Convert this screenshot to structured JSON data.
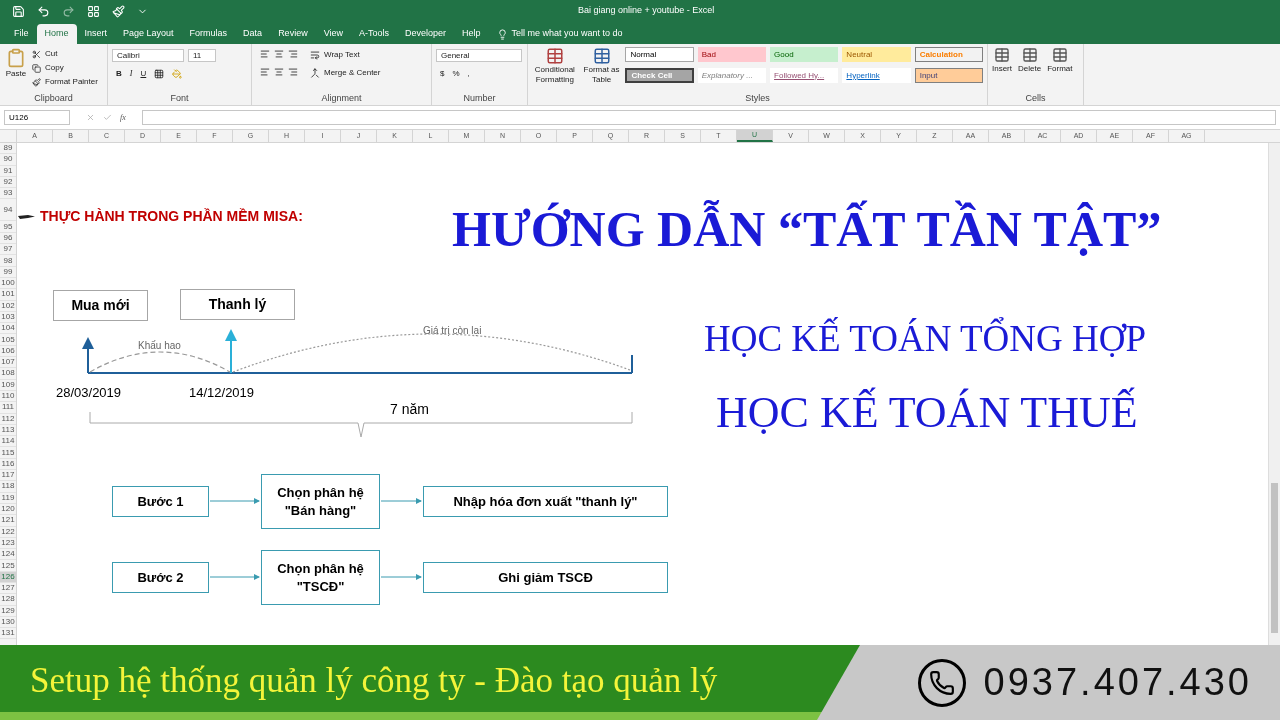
{
  "window": {
    "title": "Bai giang online + youtube  -  Excel"
  },
  "tabs": [
    {
      "label": "File",
      "selected": false
    },
    {
      "label": "Home",
      "selected": true
    },
    {
      "label": "Insert",
      "selected": false
    },
    {
      "label": "Page Layout",
      "selected": false
    },
    {
      "label": "Formulas",
      "selected": false
    },
    {
      "label": "Data",
      "selected": false
    },
    {
      "label": "Review",
      "selected": false
    },
    {
      "label": "View",
      "selected": false
    },
    {
      "label": "A-Tools",
      "selected": false
    },
    {
      "label": "Developer",
      "selected": false
    },
    {
      "label": "Help",
      "selected": false
    }
  ],
  "tell_me": "Tell me what you want to do",
  "ribbon": {
    "clipboard": {
      "paste": "Paste",
      "cut": "Cut",
      "copy": "Copy",
      "format_painter": "Format Painter",
      "label": "Clipboard"
    },
    "font": {
      "name": "Calibri",
      "size": "11",
      "styles": [
        "B",
        "I",
        "U"
      ],
      "label": "Font"
    },
    "alignment": {
      "wrap": "Wrap Text",
      "merge": "Merge & Center",
      "label": "Alignment"
    },
    "number": {
      "format": "General",
      "symbols": [
        "$",
        "%",
        ","
      ],
      "label": "Number"
    },
    "styles": {
      "conditional": [
        "Conditional",
        "Formatting"
      ],
      "table": [
        "Format as",
        "Table"
      ],
      "label": "Styles",
      "cells": [
        {
          "label": "Normal",
          "kind": "normal"
        },
        {
          "label": "Bad",
          "kind": "bad"
        },
        {
          "label": "Good",
          "kind": "good"
        },
        {
          "label": "Neutral",
          "kind": "neutral"
        },
        {
          "label": "Calculation",
          "kind": "calculation"
        },
        {
          "label": "Check Cell",
          "kind": "check"
        },
        {
          "label": "Explanatory ...",
          "kind": "explanatory"
        },
        {
          "label": "Followed Hy...",
          "kind": "followed"
        },
        {
          "label": "Hyperlink",
          "kind": "hyperlink"
        },
        {
          "label": "Input",
          "kind": "input"
        }
      ]
    },
    "cells": {
      "buttons": [
        "Insert",
        "Delete",
        "Format"
      ],
      "label": "Cells"
    }
  },
  "formula_bar": {
    "name_box": "U126",
    "fx": "fx"
  },
  "columns": [
    {
      "label": "A",
      "selected": false
    },
    {
      "label": "B",
      "selected": false
    },
    {
      "label": "C",
      "selected": false
    },
    {
      "label": "D",
      "selected": false
    },
    {
      "label": "E",
      "selected": false
    },
    {
      "label": "F",
      "selected": false
    },
    {
      "label": "G",
      "selected": false
    },
    {
      "label": "H",
      "selected": false
    },
    {
      "label": "I",
      "selected": false
    },
    {
      "label": "J",
      "selected": false
    },
    {
      "label": "K",
      "selected": false
    },
    {
      "label": "L",
      "selected": false
    },
    {
      "label": "M",
      "selected": false
    },
    {
      "label": "N",
      "selected": false
    },
    {
      "label": "O",
      "selected": false
    },
    {
      "label": "P",
      "selected": false
    },
    {
      "label": "Q",
      "selected": false
    },
    {
      "label": "R",
      "selected": false
    },
    {
      "label": "S",
      "selected": false
    },
    {
      "label": "T",
      "selected": false
    },
    {
      "label": "U",
      "selected": true
    },
    {
      "label": "V",
      "selected": false
    },
    {
      "label": "W",
      "selected": false
    },
    {
      "label": "X",
      "selected": false
    },
    {
      "label": "Y",
      "selected": false
    },
    {
      "label": "Z",
      "selected": false
    },
    {
      "label": "AA",
      "selected": false
    },
    {
      "label": "AB",
      "selected": false
    },
    {
      "label": "AC",
      "selected": false
    },
    {
      "label": "AD",
      "selected": false
    },
    {
      "label": "AE",
      "selected": false
    },
    {
      "label": "AF",
      "selected": false
    },
    {
      "label": "AG",
      "selected": false
    }
  ],
  "rows": [
    {
      "label": "89",
      "selected": false
    },
    {
      "label": "90",
      "selected": false
    },
    {
      "label": "91",
      "selected": false
    },
    {
      "label": "92",
      "selected": false
    },
    {
      "label": "93",
      "selected": false
    },
    {
      "label": "94",
      "selected": false
    },
    {
      "label": "95",
      "selected": false
    },
    {
      "label": "96",
      "selected": false
    },
    {
      "label": "97",
      "selected": false
    },
    {
      "label": "98",
      "selected": false
    },
    {
      "label": "99",
      "selected": false
    },
    {
      "label": "100",
      "selected": false
    },
    {
      "label": "101",
      "selected": false
    },
    {
      "label": "102",
      "selected": false
    },
    {
      "label": "103",
      "selected": false
    },
    {
      "label": "104",
      "selected": false
    },
    {
      "label": "105",
      "selected": false
    },
    {
      "label": "106",
      "selected": false
    },
    {
      "label": "107",
      "selected": false
    },
    {
      "label": "108",
      "selected": false
    },
    {
      "label": "109",
      "selected": false
    },
    {
      "label": "110",
      "selected": false
    },
    {
      "label": "111",
      "selected": false
    },
    {
      "label": "112",
      "selected": false
    },
    {
      "label": "113",
      "selected": false
    },
    {
      "label": "114",
      "selected": false
    },
    {
      "label": "115",
      "selected": false
    },
    {
      "label": "116",
      "selected": false
    },
    {
      "label": "117",
      "selected": false
    },
    {
      "label": "118",
      "selected": false
    },
    {
      "label": "119",
      "selected": false
    },
    {
      "label": "120",
      "selected": false
    },
    {
      "label": "121",
      "selected": false
    },
    {
      "label": "122",
      "selected": false
    },
    {
      "label": "123",
      "selected": false
    },
    {
      "label": "124",
      "selected": false
    },
    {
      "label": "125",
      "selected": false
    },
    {
      "label": "126",
      "selected": true
    },
    {
      "label": "127",
      "selected": false
    },
    {
      "label": "128",
      "selected": false
    },
    {
      "label": "129",
      "selected": false
    },
    {
      "label": "130",
      "selected": false
    },
    {
      "label": "131",
      "selected": false
    }
  ],
  "sheet": {
    "heading": "THỰC HÀNH TRONG PHẦN MỀM MISA:",
    "title": "HƯỚNG DẪN “TẤT TẦN TẬT”",
    "subtitles": [
      "HỌC KẾ TOÁN TỔNG HỢP",
      "HỌC KẾ TOÁN THUẾ"
    ],
    "timeline": {
      "events": [
        {
          "label": "Mua mới",
          "date": "28/03/2019"
        },
        {
          "label": "Thanh lý",
          "date": "14/12/2019"
        }
      ],
      "segments": [
        {
          "label": "Khấu hao",
          "kind": "dashed"
        },
        {
          "label": "Giá trị còn lại",
          "kind": "dotted"
        }
      ],
      "span": "7 năm"
    },
    "steps": [
      {
        "label": "Bước 1",
        "module": "Chọn phân hệ\n\"Bán hàng\"",
        "action": "Nhập hóa đơn xuất \"thanh lý\""
      },
      {
        "label": "Bước 2",
        "module": "Chọn phân hệ\n\"TSCĐ\"",
        "action": "Ghi giảm TSCĐ"
      }
    ]
  },
  "banner": {
    "slogan": "Setup hệ thống quản lý công ty - Đào tạo quản lý",
    "phone": "0937.407.430"
  }
}
